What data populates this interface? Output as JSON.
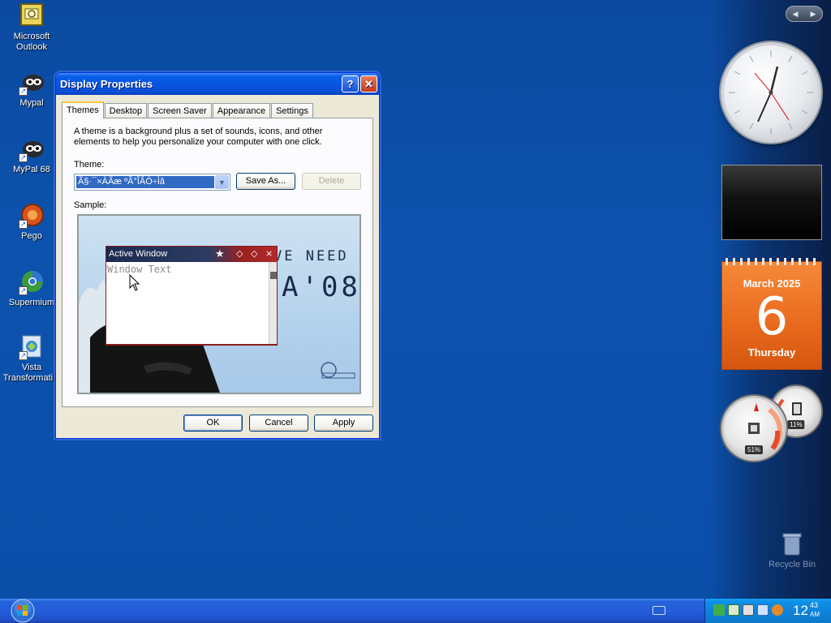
{
  "desktop": {
    "icons": [
      {
        "label": "Microsoft Outlook",
        "icon": "outlook-icon"
      },
      {
        "label": "Mypal",
        "icon": "mypal-icon"
      },
      {
        "label": "MyPal 68",
        "icon": "mypal68-icon"
      },
      {
        "label": "Pego",
        "icon": "pego-icon"
      },
      {
        "label": "Supermium",
        "icon": "supermium-icon"
      },
      {
        "label": "Vista Transformati...",
        "icon": "vista-transformation-icon"
      }
    ],
    "recycle_bin": "Recycle Bin"
  },
  "sidebar": {
    "nav_prev": "◀",
    "nav_next": "▶",
    "calendar": {
      "month": "March 2025",
      "day": "6",
      "weekday": "Thursday"
    },
    "cpu_meter": {
      "cpu": "51%",
      "memory": "11%"
    }
  },
  "dialog": {
    "title": "Display Properties",
    "help_button": "?",
    "close_button": "✕",
    "tabs": [
      "Themes",
      "Desktop",
      "Screen Saver",
      "Appearance",
      "Settings"
    ],
    "description": "A theme is a background plus a set of sounds, icons, and other elements to help you personalize your computer with one click.",
    "theme_label": "Theme:",
    "theme_value": "Ã§·¯×ÀÃæ ºÃ°ÎÂÖ÷Ìâ",
    "save_as": "Save As...",
    "delete": "Delete",
    "sample_label": "Sample:",
    "preview": {
      "window_title": "Active Window",
      "window_text": "Window Text",
      "line1": "VE NEED",
      "line2": "A'08"
    },
    "ok": "OK",
    "cancel": "Cancel",
    "apply": "Apply"
  },
  "taskbar": {
    "clock_hour": "12",
    "clock_min": "43",
    "clock_ampm": "AM"
  },
  "colors": {
    "desktop_bg": "#0c52ad",
    "taskbar": "#245edb",
    "tray": "#0e84db",
    "calendar": "#e8691c"
  }
}
